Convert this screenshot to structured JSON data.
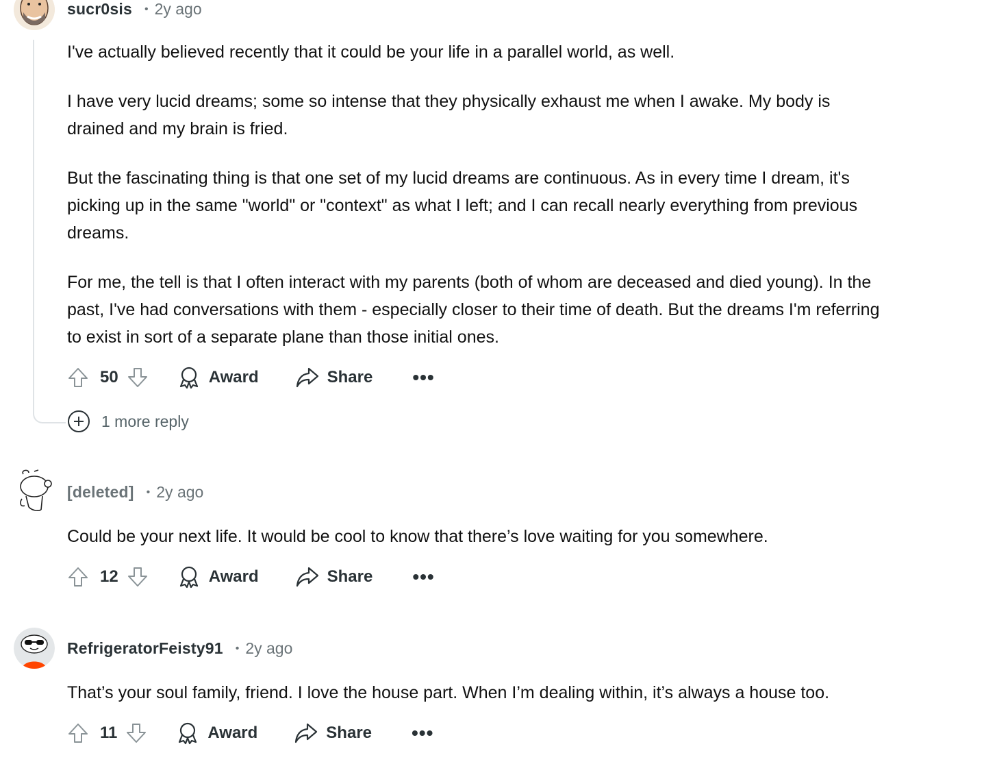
{
  "comments": [
    {
      "author": "sucr0sis",
      "dot": "•",
      "time": "2y ago",
      "paragraphs": [
        "I've actually believed recently that it could be your life in a parallel world, as well.",
        "I have very lucid dreams; some so intense that they physically exhaust me when I awake. My body is",
        "drained and my brain is fried.",
        "But the fascinating thing is that one set of my lucid dreams are continuous. As in every time I dream, it's",
        "picking up in the same \"world\" or \"context\" as what I left; and I can recall nearly everything from previous",
        "dreams.",
        "For me, the tell is that I often interact with my parents (both of whom are deceased and died young). In the",
        "past, I've had conversations with them - especially closer to their time of death. But the dreams I'm referring",
        "to exist in sort of a separate plane than those initial ones."
      ],
      "score": "50",
      "award_label": "Award",
      "share_label": "Share",
      "more_label": "•••",
      "more_replies": "1 more reply"
    },
    {
      "author": "[deleted]",
      "dot": "•",
      "time": "2y ago",
      "paragraphs": [
        "Could be your next life. It would be cool to know that there’s love waiting for you somewhere."
      ],
      "score": "12",
      "award_label": "Award",
      "share_label": "Share",
      "more_label": "•••"
    },
    {
      "author": "RefrigeratorFeisty91",
      "dot": "•",
      "time": "2y ago",
      "paragraphs": [
        "That’s your soul family, friend. I love the house part. When I’m dealing within, it’s always a house too."
      ],
      "score": "11",
      "award_label": "Award",
      "share_label": "Share",
      "more_label": "•••"
    }
  ],
  "colors": {
    "thread_line": "#dfe3e6",
    "meta_gray": "#6a7377",
    "text": "#111111",
    "avatar_orange": "#ff4500"
  },
  "icons": [
    "upvote-icon",
    "downvote-icon",
    "award-icon",
    "share-icon",
    "plus-circle-icon"
  ]
}
